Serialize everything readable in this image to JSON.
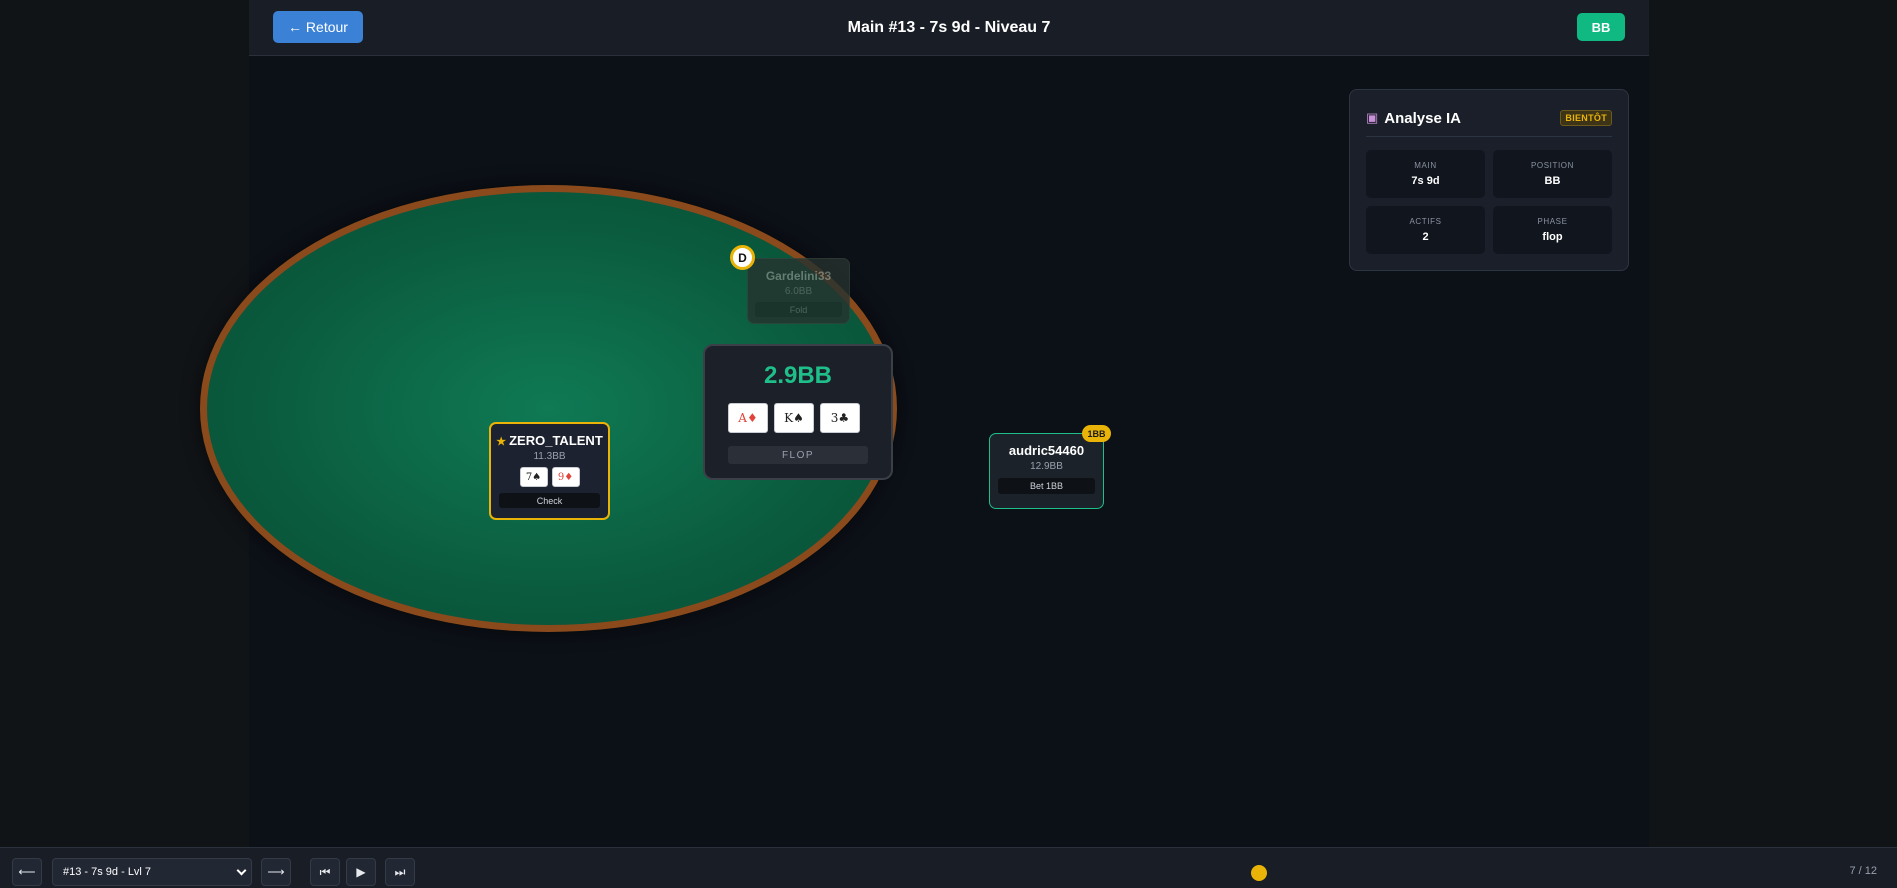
{
  "header": {
    "back_label": "← Retour",
    "title": "Main #13 - 7s 9d - Niveau 7",
    "position_badge": "BB"
  },
  "ai_panel": {
    "icon": "robot-icon",
    "title": "Analyse IA",
    "badge": "BIENTÔT",
    "stats": [
      {
        "label": "MAIN",
        "value": "7s 9d"
      },
      {
        "label": "POSITION",
        "value": "BB"
      },
      {
        "label": "ACTIFS",
        "value": "2"
      },
      {
        "label": "PHASE",
        "value": "flop"
      }
    ]
  },
  "table": {
    "pot": "2.9BB",
    "board": [
      {
        "text": "A♦",
        "color": "#e0443a"
      },
      {
        "text": "K♠",
        "color": "#222222"
      },
      {
        "text": "3♣",
        "color": "#222222"
      }
    ],
    "phase": "FLOP",
    "dealer_button": "D"
  },
  "players": {
    "top": {
      "name": "Gardelini33",
      "stack": "6.0BB",
      "action": "Fold"
    },
    "left": {
      "name": "ZERO_TALENT",
      "hero_marker": "★",
      "stack": "11.3BB",
      "cards": [
        {
          "text": "7♠",
          "color": "#222222"
        },
        {
          "text": "9♦",
          "color": "#e0443a"
        }
      ],
      "action": "Check"
    },
    "right": {
      "name": "audric54460",
      "stack": "12.9BB",
      "action": "Bet 1BB",
      "bet": "1BB"
    }
  },
  "controls": {
    "prev": "⟵",
    "hand_select": "#13 - 7s 9d - Lvl 7",
    "next": "⟶",
    "first": "⏮",
    "play": "▶",
    "last": "⏭",
    "step": "7 / 12"
  },
  "colors": {
    "accent_blue": "#3b82d6",
    "accent_green": "#10b981",
    "hero_gold": "#eab308",
    "felt": "#0b5e40",
    "rail": "#8a4a1c"
  }
}
